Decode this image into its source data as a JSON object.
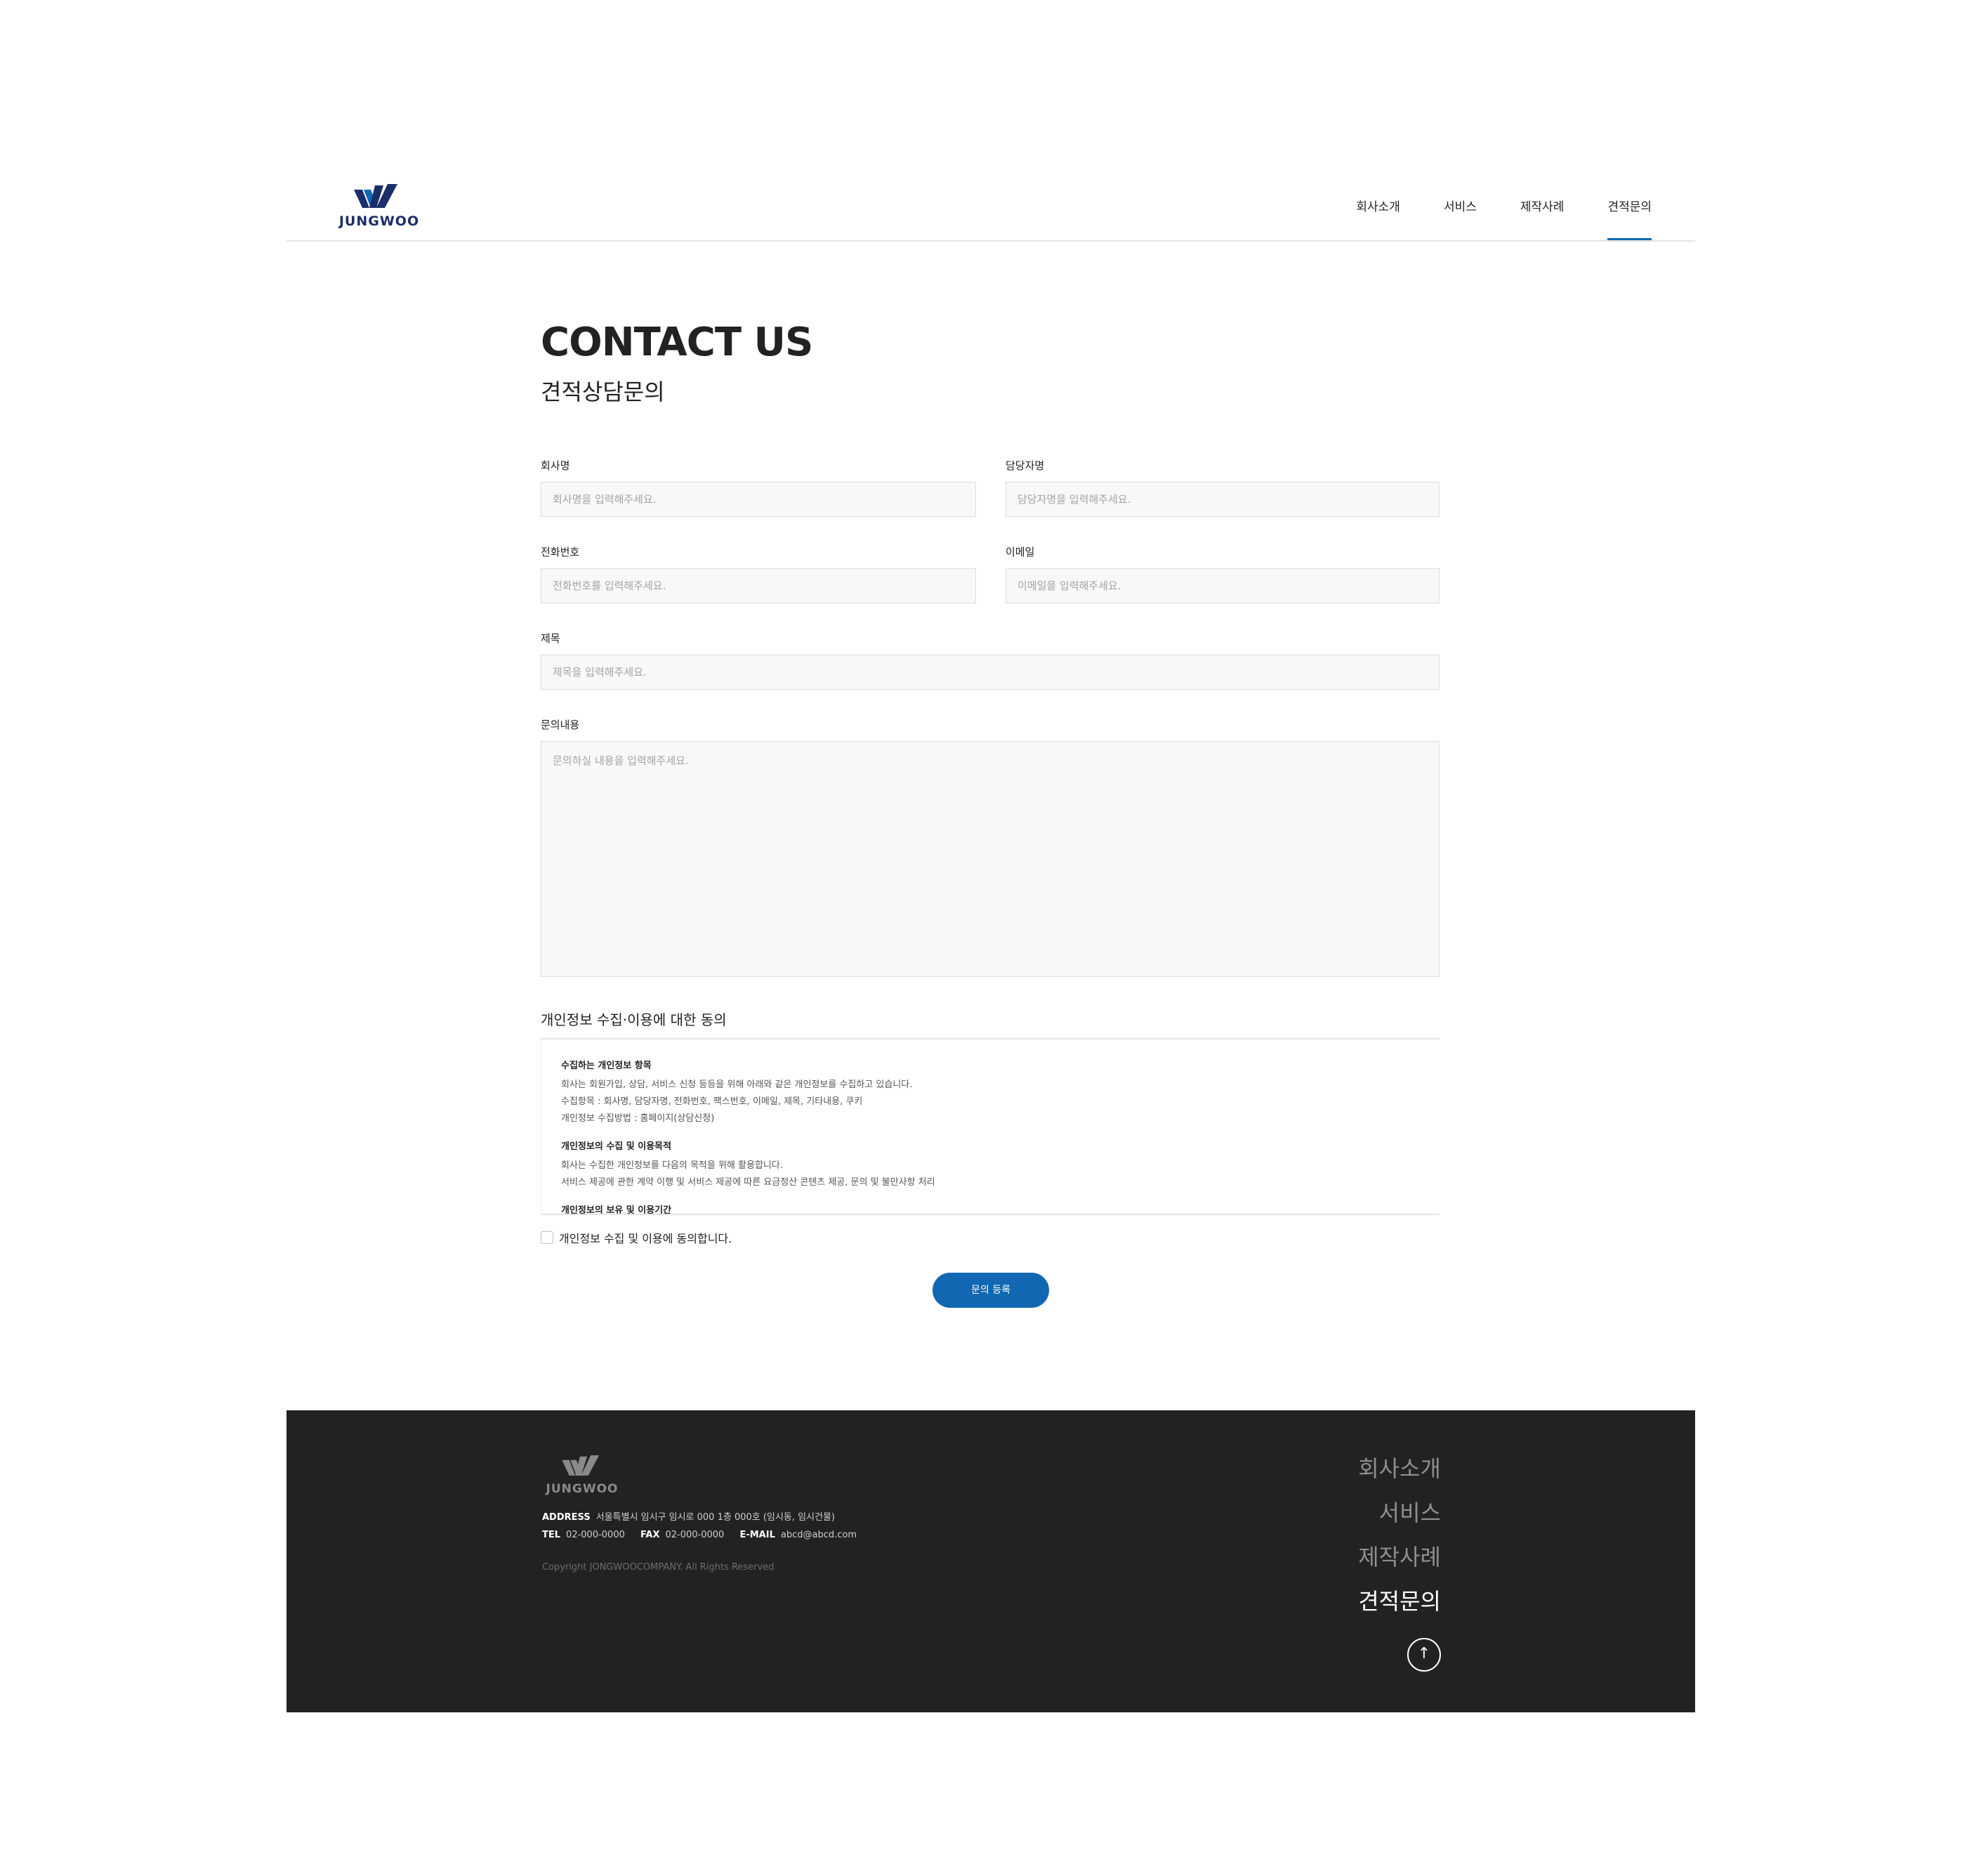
{
  "header": {
    "logo_text": "JUNGWOO",
    "nav": [
      "회사소개",
      "서비스",
      "제작사례",
      "견적문의"
    ]
  },
  "main": {
    "title": "CONTACT US",
    "subtitle": "견적상담문의"
  },
  "form": {
    "company": {
      "label": "회사명",
      "placeholder": "회사명을 입력해주세요."
    },
    "manager": {
      "label": "담당자명",
      "placeholder": "담당자명을 입력해주세요."
    },
    "phone": {
      "label": "전화번호",
      "placeholder": "전화번호를 입력해주세요."
    },
    "email": {
      "label": "이메일",
      "placeholder": "이메일을 입력해주세요."
    },
    "subject": {
      "label": "제목",
      "placeholder": "제목을 입력해주세요."
    },
    "content": {
      "label": "문의내용",
      "placeholder": "문의하실 내용을 입력해주세요."
    }
  },
  "consent": {
    "title": "개인정보 수집·이용에 대한 동의",
    "sections": [
      {
        "heading": "수집하는 개인정보 항목",
        "lines": [
          "회사는 회원가입, 상담, 서비스 신청 등등을 위해 아래와 같은 개인정보를 수집하고 있습니다.",
          "수집항목 : 회사명, 담당자명, 전화번호, 팩스번호, 이메일, 제목, 기타내용, 쿠키",
          "개인정보 수집방법 : 홈페이지(상담신청)"
        ]
      },
      {
        "heading": "개인정보의 수집 및 이용목적",
        "lines": [
          "회사는 수집한 개인정보를 다음의 목적을 위해 활용합니다.",
          "서비스 제공에 관한 계약 이행 및 서비스 제공에 따른 요금정산 콘텐츠 제공, 문의 및 불만사항 처리"
        ]
      },
      {
        "heading": "개인정보의 보유 및 이용기간",
        "lines": []
      }
    ],
    "agree_label": "개인정보 수집 및 이용에 동의합니다."
  },
  "submit_label": "문의 등록",
  "footer": {
    "logo_text": "JUNGWOO",
    "address_label": "ADDRESS",
    "address": "서울특별시 임시구 임시로 000 1층 000호 (임시동, 임시건물)",
    "tel_label": "TEL",
    "tel": "02-000-0000",
    "fax_label": "FAX",
    "fax": "02-000-0000",
    "email_label": "E-MAIL",
    "email": "abcd@abcd.com",
    "copyright": "Copyright JONGWOOCOMPANY. All Rights Reserved",
    "nav": [
      "회사소개",
      "서비스",
      "제작사례",
      "견적문의"
    ],
    "top_icon": "arrow-up-icon"
  },
  "colors": {
    "accent": "#1167b1",
    "logo_navy": "#1c2d6b",
    "footer_bg": "#222222",
    "field_bg": "#f7f8fa"
  }
}
